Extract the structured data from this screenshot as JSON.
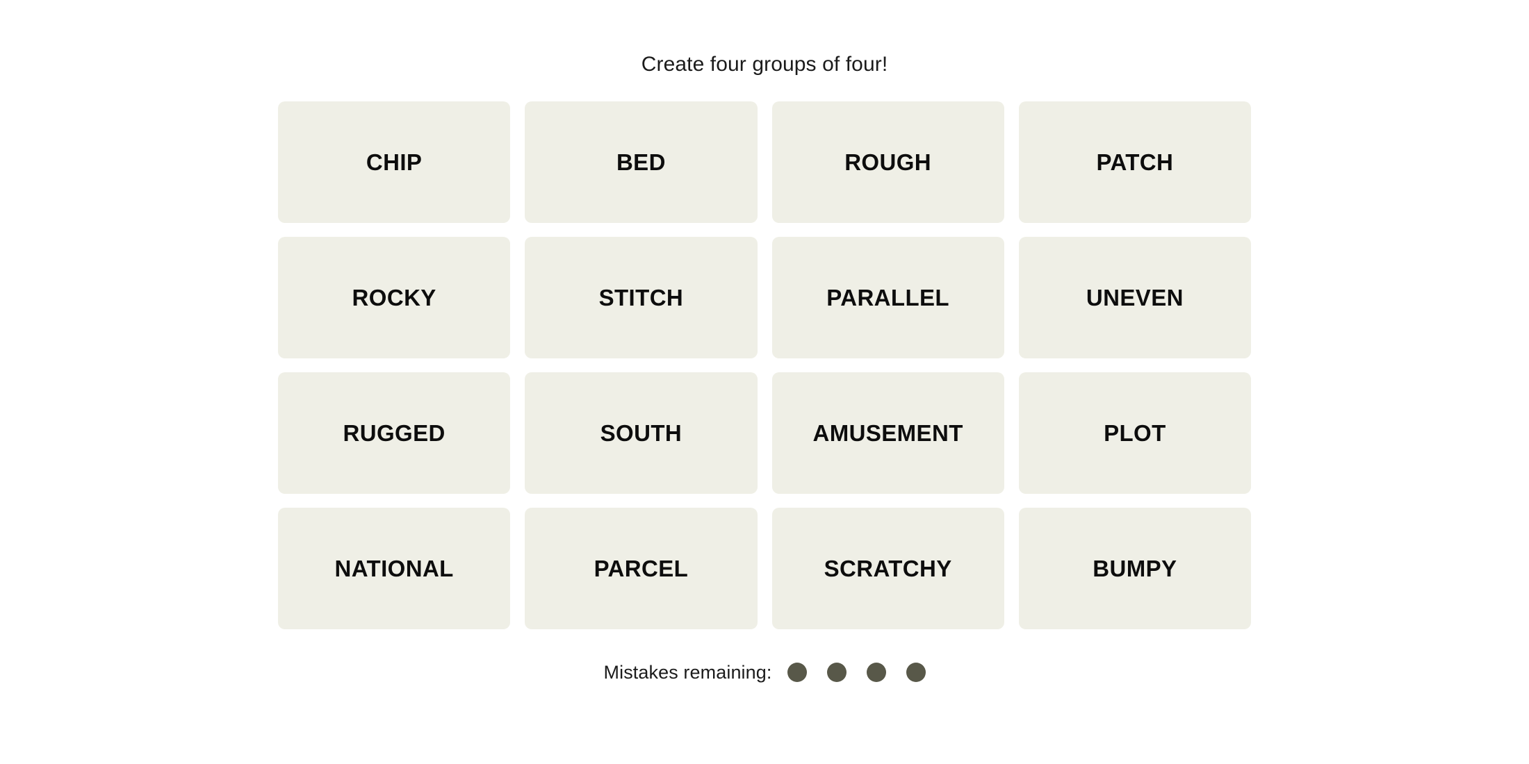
{
  "game": {
    "instruction": "Create four groups of four!",
    "tile_background": "#EFEFE6",
    "tile_text_color": "#0d0d0d",
    "page_background": "#FFFFFF",
    "grid": {
      "rows": 4,
      "columns": 4,
      "tiles": [
        {
          "label": "CHIP"
        },
        {
          "label": "BED"
        },
        {
          "label": "ROUGH"
        },
        {
          "label": "PATCH"
        },
        {
          "label": "ROCKY"
        },
        {
          "label": "STITCH"
        },
        {
          "label": "PARALLEL"
        },
        {
          "label": "UNEVEN"
        },
        {
          "label": "RUGGED"
        },
        {
          "label": "SOUTH"
        },
        {
          "label": "AMUSEMENT"
        },
        {
          "label": "PLOT"
        },
        {
          "label": "NATIONAL"
        },
        {
          "label": "PARCEL"
        },
        {
          "label": "SCRATCHY"
        },
        {
          "label": "BUMPY"
        }
      ]
    },
    "mistakes": {
      "label": "Mistakes remaining:",
      "remaining": 4,
      "total": 4,
      "dot_color": "#585849"
    }
  }
}
